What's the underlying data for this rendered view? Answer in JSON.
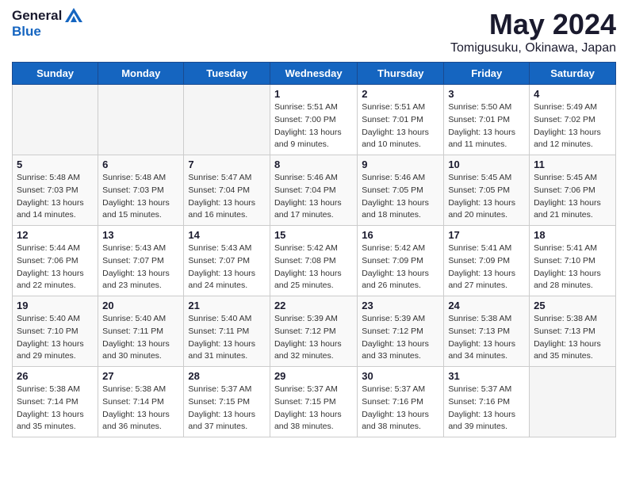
{
  "logo": {
    "general": "General",
    "blue": "Blue"
  },
  "header": {
    "month": "May 2024",
    "location": "Tomigusuku, Okinawa, Japan"
  },
  "weekdays": [
    "Sunday",
    "Monday",
    "Tuesday",
    "Wednesday",
    "Thursday",
    "Friday",
    "Saturday"
  ],
  "weeks": [
    [
      {
        "day": "",
        "sunrise": "",
        "sunset": "",
        "daylight": ""
      },
      {
        "day": "",
        "sunrise": "",
        "sunset": "",
        "daylight": ""
      },
      {
        "day": "",
        "sunrise": "",
        "sunset": "",
        "daylight": ""
      },
      {
        "day": "1",
        "sunrise": "Sunrise: 5:51 AM",
        "sunset": "Sunset: 7:00 PM",
        "daylight": "Daylight: 13 hours and 9 minutes."
      },
      {
        "day": "2",
        "sunrise": "Sunrise: 5:51 AM",
        "sunset": "Sunset: 7:01 PM",
        "daylight": "Daylight: 13 hours and 10 minutes."
      },
      {
        "day": "3",
        "sunrise": "Sunrise: 5:50 AM",
        "sunset": "Sunset: 7:01 PM",
        "daylight": "Daylight: 13 hours and 11 minutes."
      },
      {
        "day": "4",
        "sunrise": "Sunrise: 5:49 AM",
        "sunset": "Sunset: 7:02 PM",
        "daylight": "Daylight: 13 hours and 12 minutes."
      }
    ],
    [
      {
        "day": "5",
        "sunrise": "Sunrise: 5:48 AM",
        "sunset": "Sunset: 7:03 PM",
        "daylight": "Daylight: 13 hours and 14 minutes."
      },
      {
        "day": "6",
        "sunrise": "Sunrise: 5:48 AM",
        "sunset": "Sunset: 7:03 PM",
        "daylight": "Daylight: 13 hours and 15 minutes."
      },
      {
        "day": "7",
        "sunrise": "Sunrise: 5:47 AM",
        "sunset": "Sunset: 7:04 PM",
        "daylight": "Daylight: 13 hours and 16 minutes."
      },
      {
        "day": "8",
        "sunrise": "Sunrise: 5:46 AM",
        "sunset": "Sunset: 7:04 PM",
        "daylight": "Daylight: 13 hours and 17 minutes."
      },
      {
        "day": "9",
        "sunrise": "Sunrise: 5:46 AM",
        "sunset": "Sunset: 7:05 PM",
        "daylight": "Daylight: 13 hours and 18 minutes."
      },
      {
        "day": "10",
        "sunrise": "Sunrise: 5:45 AM",
        "sunset": "Sunset: 7:05 PM",
        "daylight": "Daylight: 13 hours and 20 minutes."
      },
      {
        "day": "11",
        "sunrise": "Sunrise: 5:45 AM",
        "sunset": "Sunset: 7:06 PM",
        "daylight": "Daylight: 13 hours and 21 minutes."
      }
    ],
    [
      {
        "day": "12",
        "sunrise": "Sunrise: 5:44 AM",
        "sunset": "Sunset: 7:06 PM",
        "daylight": "Daylight: 13 hours and 22 minutes."
      },
      {
        "day": "13",
        "sunrise": "Sunrise: 5:43 AM",
        "sunset": "Sunset: 7:07 PM",
        "daylight": "Daylight: 13 hours and 23 minutes."
      },
      {
        "day": "14",
        "sunrise": "Sunrise: 5:43 AM",
        "sunset": "Sunset: 7:07 PM",
        "daylight": "Daylight: 13 hours and 24 minutes."
      },
      {
        "day": "15",
        "sunrise": "Sunrise: 5:42 AM",
        "sunset": "Sunset: 7:08 PM",
        "daylight": "Daylight: 13 hours and 25 minutes."
      },
      {
        "day": "16",
        "sunrise": "Sunrise: 5:42 AM",
        "sunset": "Sunset: 7:09 PM",
        "daylight": "Daylight: 13 hours and 26 minutes."
      },
      {
        "day": "17",
        "sunrise": "Sunrise: 5:41 AM",
        "sunset": "Sunset: 7:09 PM",
        "daylight": "Daylight: 13 hours and 27 minutes."
      },
      {
        "day": "18",
        "sunrise": "Sunrise: 5:41 AM",
        "sunset": "Sunset: 7:10 PM",
        "daylight": "Daylight: 13 hours and 28 minutes."
      }
    ],
    [
      {
        "day": "19",
        "sunrise": "Sunrise: 5:40 AM",
        "sunset": "Sunset: 7:10 PM",
        "daylight": "Daylight: 13 hours and 29 minutes."
      },
      {
        "day": "20",
        "sunrise": "Sunrise: 5:40 AM",
        "sunset": "Sunset: 7:11 PM",
        "daylight": "Daylight: 13 hours and 30 minutes."
      },
      {
        "day": "21",
        "sunrise": "Sunrise: 5:40 AM",
        "sunset": "Sunset: 7:11 PM",
        "daylight": "Daylight: 13 hours and 31 minutes."
      },
      {
        "day": "22",
        "sunrise": "Sunrise: 5:39 AM",
        "sunset": "Sunset: 7:12 PM",
        "daylight": "Daylight: 13 hours and 32 minutes."
      },
      {
        "day": "23",
        "sunrise": "Sunrise: 5:39 AM",
        "sunset": "Sunset: 7:12 PM",
        "daylight": "Daylight: 13 hours and 33 minutes."
      },
      {
        "day": "24",
        "sunrise": "Sunrise: 5:38 AM",
        "sunset": "Sunset: 7:13 PM",
        "daylight": "Daylight: 13 hours and 34 minutes."
      },
      {
        "day": "25",
        "sunrise": "Sunrise: 5:38 AM",
        "sunset": "Sunset: 7:13 PM",
        "daylight": "Daylight: 13 hours and 35 minutes."
      }
    ],
    [
      {
        "day": "26",
        "sunrise": "Sunrise: 5:38 AM",
        "sunset": "Sunset: 7:14 PM",
        "daylight": "Daylight: 13 hours and 35 minutes."
      },
      {
        "day": "27",
        "sunrise": "Sunrise: 5:38 AM",
        "sunset": "Sunset: 7:14 PM",
        "daylight": "Daylight: 13 hours and 36 minutes."
      },
      {
        "day": "28",
        "sunrise": "Sunrise: 5:37 AM",
        "sunset": "Sunset: 7:15 PM",
        "daylight": "Daylight: 13 hours and 37 minutes."
      },
      {
        "day": "29",
        "sunrise": "Sunrise: 5:37 AM",
        "sunset": "Sunset: 7:15 PM",
        "daylight": "Daylight: 13 hours and 38 minutes."
      },
      {
        "day": "30",
        "sunrise": "Sunrise: 5:37 AM",
        "sunset": "Sunset: 7:16 PM",
        "daylight": "Daylight: 13 hours and 38 minutes."
      },
      {
        "day": "31",
        "sunrise": "Sunrise: 5:37 AM",
        "sunset": "Sunset: 7:16 PM",
        "daylight": "Daylight: 13 hours and 39 minutes."
      },
      {
        "day": "",
        "sunrise": "",
        "sunset": "",
        "daylight": ""
      }
    ]
  ]
}
